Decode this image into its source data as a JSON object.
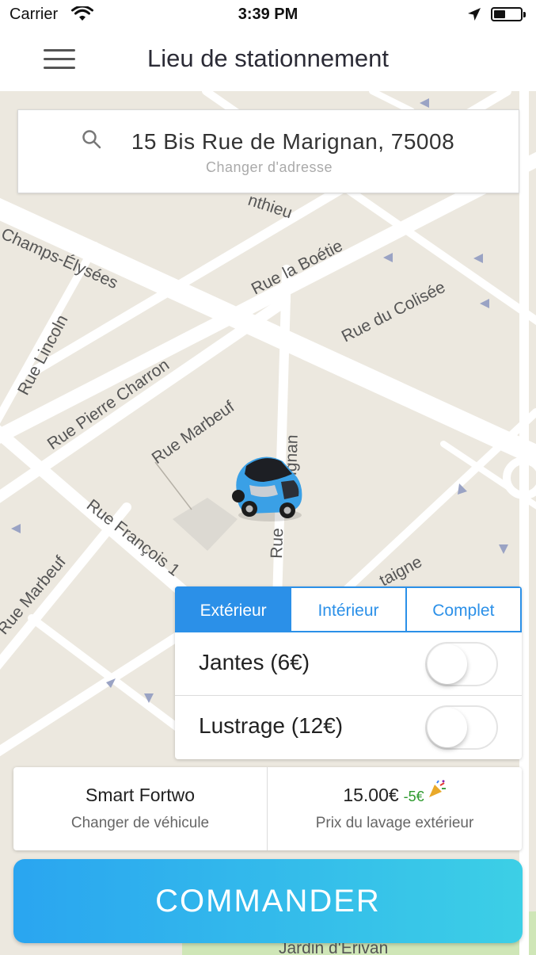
{
  "status_bar": {
    "carrier": "Carrier",
    "time": "3:39 PM"
  },
  "nav": {
    "title": "Lieu de stationnement",
    "menu_icon": "hamburger-menu-icon"
  },
  "map": {
    "streets": [
      "Champs-Élysées",
      "Rue la Boétie",
      "Rue du Colisée",
      "Rue Lincoln",
      "Rue Pierre Charron",
      "Rue Marbeuf",
      "Rue François 1",
      "Rue Marbeuf",
      "nthieu",
      "Rue",
      "ignan",
      "taigne",
      "Jardin d'Erivan"
    ],
    "colors": {
      "land": "#ece8df",
      "road": "#ffffff",
      "park": "#cfe6b7"
    }
  },
  "address": {
    "value": "15 Bis Rue de Marignan, 75008",
    "subtitle": "Changer d'adresse",
    "icon": "search-icon"
  },
  "options": {
    "tabs": [
      {
        "label": "Extérieur",
        "active": true
      },
      {
        "label": "Intérieur",
        "active": false
      },
      {
        "label": "Complet",
        "active": false
      }
    ],
    "rows": [
      {
        "label": "Jantes (6€)",
        "enabled": false
      },
      {
        "label": "Lustrage (12€)",
        "enabled": false
      }
    ],
    "accent": "#2b90e8"
  },
  "summary": {
    "vehicle": "Smart Fortwo",
    "vehicle_sub": "Changer de véhicule",
    "price": "15.00€",
    "discount": "-5€",
    "price_sub": "Prix du lavage extérieur",
    "discount_color": "#2e9a2e"
  },
  "cta": {
    "label": "COMMANDER"
  }
}
